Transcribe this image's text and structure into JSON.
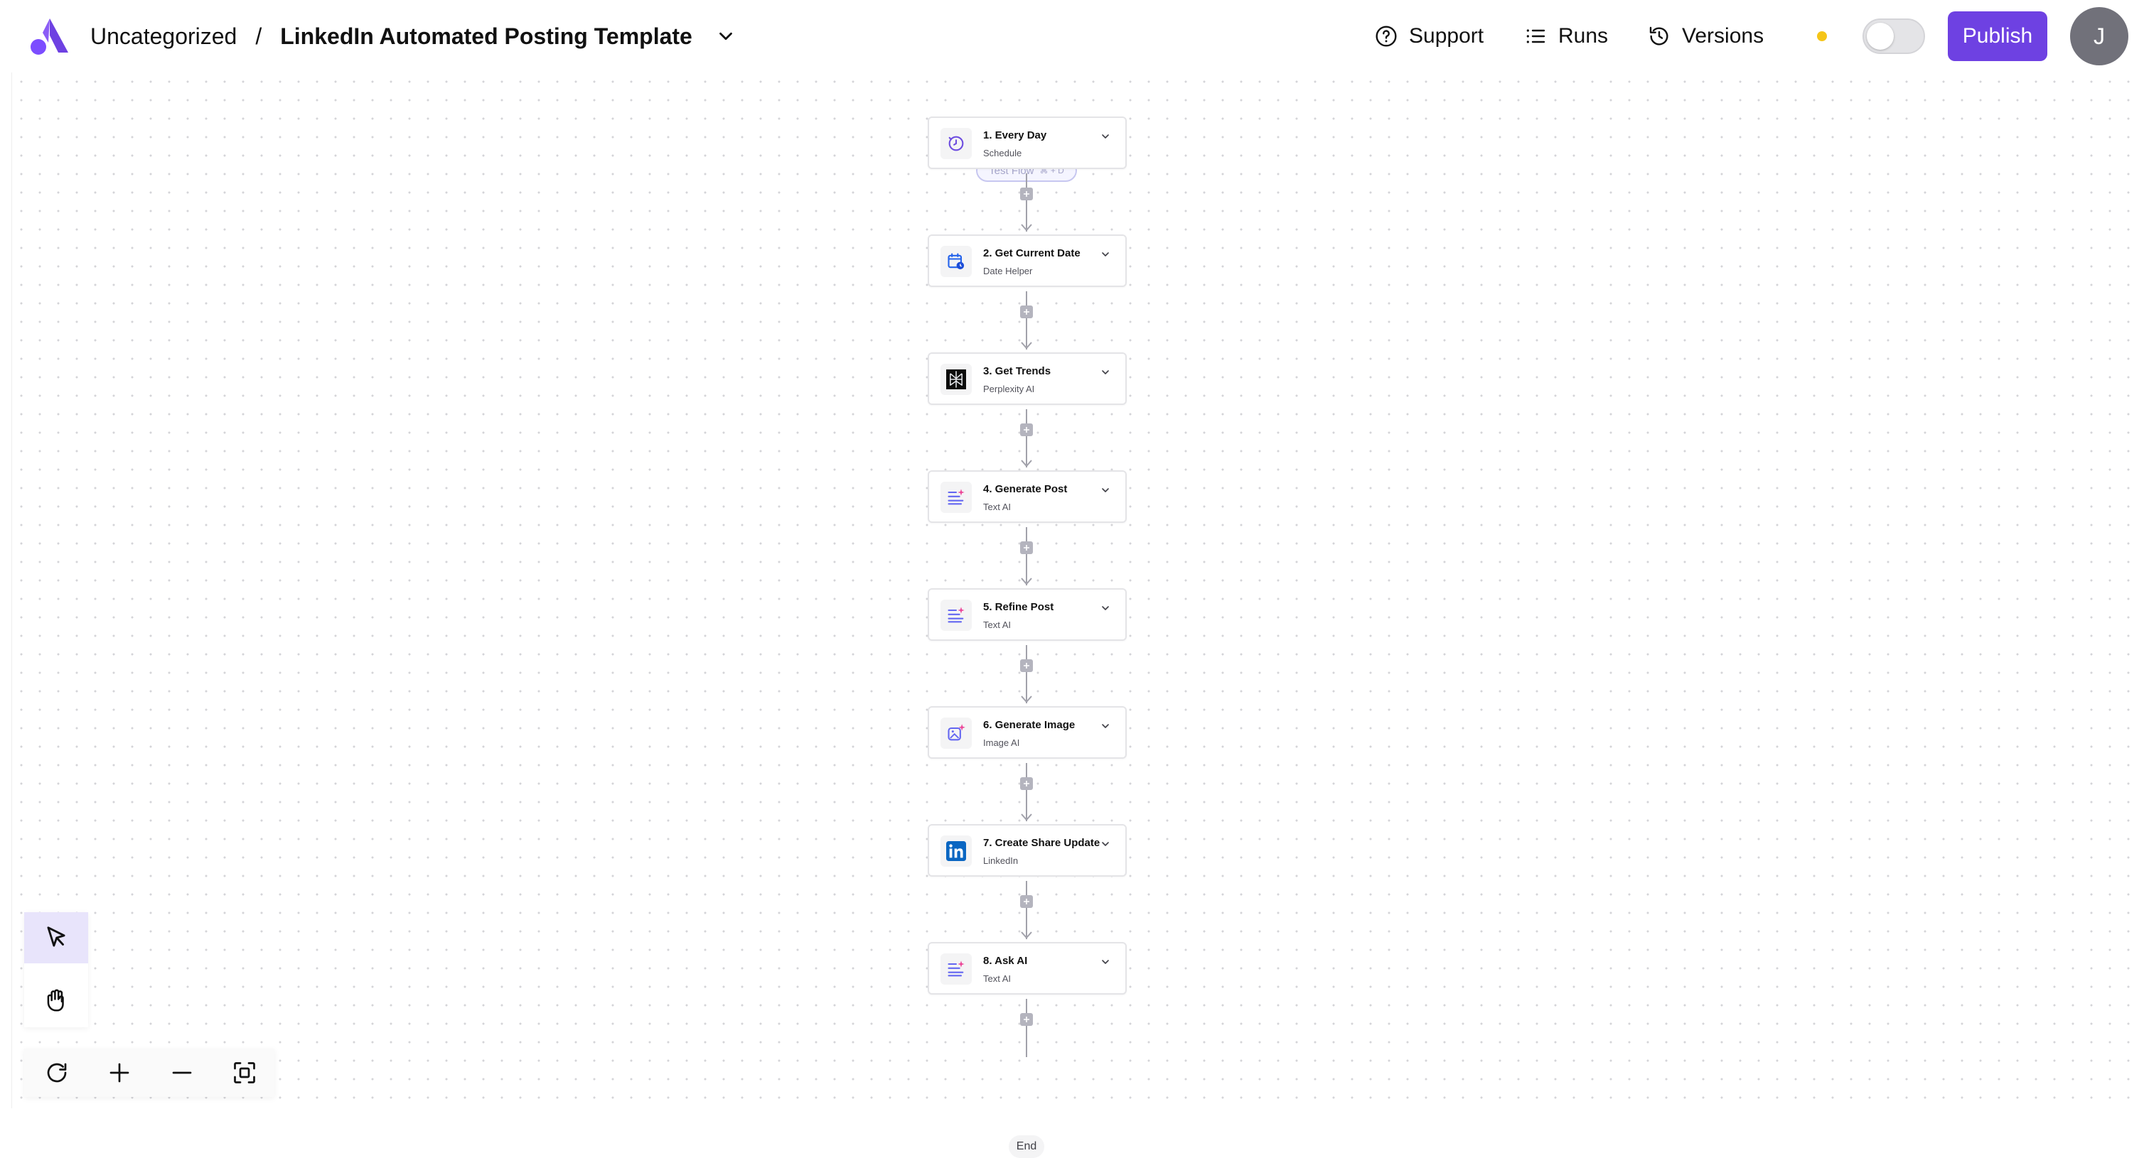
{
  "header": {
    "folder": "Uncategorized",
    "separator": "/",
    "flow_title": "LinkedIn Automated Posting Template",
    "support_label": "Support",
    "runs_label": "Runs",
    "versions_label": "Versions",
    "publish_label": "Publish",
    "avatar_initial": "J",
    "status_color": "#f5c518",
    "accent_color": "#6e41e2"
  },
  "canvas": {
    "test_flow_label": "Test Flow",
    "test_flow_shortcut": "⌘ + D",
    "end_label": "End",
    "steps": [
      {
        "title": "1. Every Day",
        "subtitle": "Schedule",
        "icon": "clock-icon"
      },
      {
        "title": "2. Get Current Date",
        "subtitle": "Date Helper",
        "icon": "calendar-icon"
      },
      {
        "title": "3. Get Trends",
        "subtitle": "Perplexity AI",
        "icon": "perplexity-icon"
      },
      {
        "title": "4. Generate Post",
        "subtitle": "Text AI",
        "icon": "text-ai-icon"
      },
      {
        "title": "5. Refine Post",
        "subtitle": "Text AI",
        "icon": "text-ai-icon"
      },
      {
        "title": "6. Generate Image",
        "subtitle": "Image AI",
        "icon": "image-ai-icon"
      },
      {
        "title": "7. Create Share Update",
        "subtitle": "LinkedIn",
        "icon": "linkedin-icon"
      },
      {
        "title": "8. Ask AI",
        "subtitle": "Text AI",
        "icon": "text-ai-icon"
      }
    ]
  },
  "tools": {
    "select": "pointer-icon",
    "pan": "hand-icon",
    "reset": "refresh-icon",
    "zoom_in": "plus-icon",
    "zoom_out": "minus-icon",
    "fit": "fit-view-icon"
  }
}
